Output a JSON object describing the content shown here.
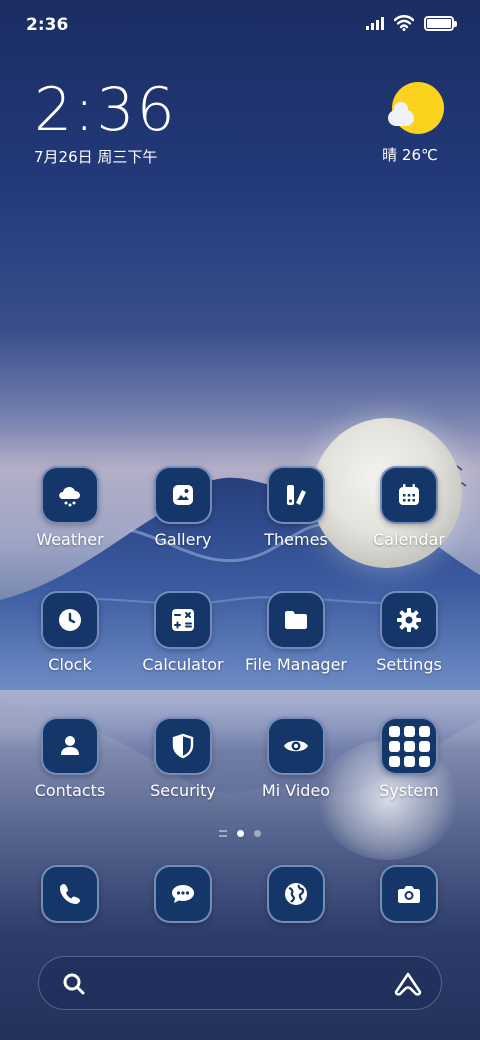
{
  "status_bar": {
    "time": "2:36"
  },
  "clock_widget": {
    "time": "2:36",
    "date": "7月26日 周三下午"
  },
  "weather_widget": {
    "condition": "晴",
    "temperature": "26℃",
    "text": "晴 26℃"
  },
  "apps": [
    {
      "label": "Weather",
      "icon": "weather-cloud-icon"
    },
    {
      "label": "Gallery",
      "icon": "gallery-image-icon"
    },
    {
      "label": "Themes",
      "icon": "themes-brush-icon"
    },
    {
      "label": "Calendar",
      "icon": "calendar-icon"
    },
    {
      "label": "Clock",
      "icon": "clock-icon"
    },
    {
      "label": "Calculator",
      "icon": "calculator-icon"
    },
    {
      "label": "File Manager",
      "icon": "folder-icon"
    },
    {
      "label": "Settings",
      "icon": "gear-icon"
    },
    {
      "label": "Contacts",
      "icon": "person-icon"
    },
    {
      "label": "Security",
      "icon": "shield-icon"
    },
    {
      "label": "Mi Video",
      "icon": "eye-icon"
    },
    {
      "label": "System",
      "icon": "folder-grid-icon"
    }
  ],
  "dock": [
    {
      "icon": "phone-icon"
    },
    {
      "icon": "message-icon"
    },
    {
      "icon": "browser-globe-icon"
    },
    {
      "icon": "camera-icon"
    }
  ],
  "page_indicator": {
    "pages": 2,
    "current": 1
  },
  "colors": {
    "tile_bg": "#153669",
    "sun": "#fbd21d"
  }
}
